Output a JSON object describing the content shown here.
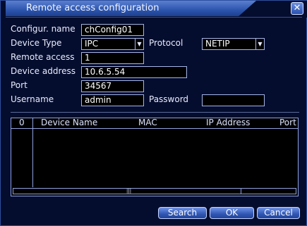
{
  "window": {
    "title": "Remote access configuration"
  },
  "form": {
    "config_name_label": "Configur. name",
    "config_name_value": "chConfig01",
    "device_type_label": "Device Type",
    "device_type_value": "IPC",
    "protocol_label": "Protocol",
    "protocol_value": "NETIP",
    "remote_access_label": "Remote access",
    "remote_access_value": "1",
    "device_address_label": "Device address",
    "device_address_value": "10.6.5.54",
    "port_label": "Port",
    "port_value": "34567",
    "username_label": "Username",
    "username_value": "admin",
    "password_label": "Password",
    "password_value": ""
  },
  "table": {
    "columns": [
      "0",
      "Device Name",
      "MAC",
      "IP Address",
      "Port"
    ],
    "rows": []
  },
  "buttons": {
    "search": "Search",
    "ok": "OK",
    "cancel": "Cancel"
  },
  "icons": {
    "close": "close-icon",
    "dropdown": "chevron-down-icon",
    "grip": "scroll-grip-icon"
  }
}
